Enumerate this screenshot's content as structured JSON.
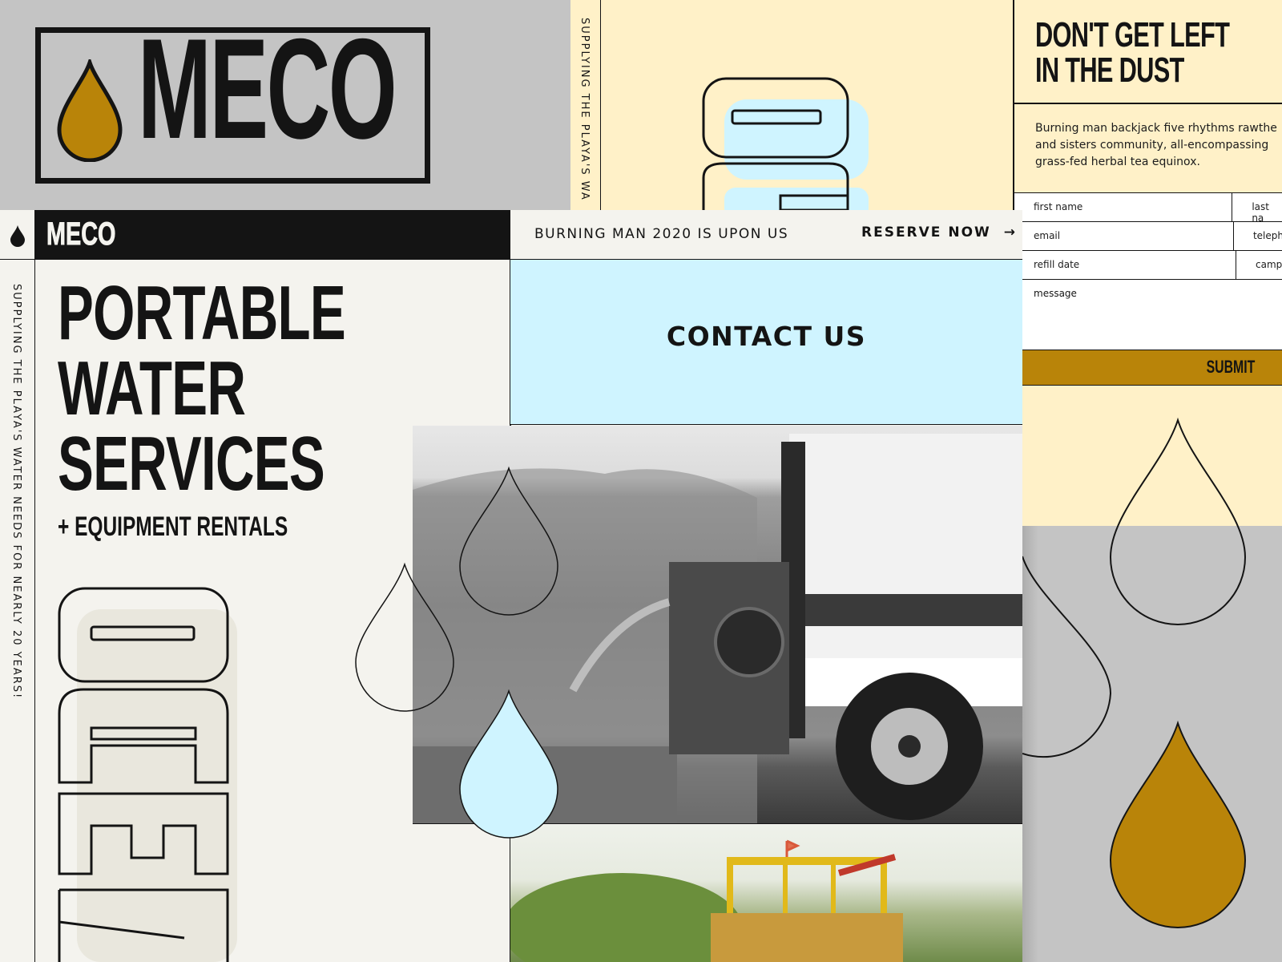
{
  "brand": {
    "logo_text": "MECO",
    "nav_logo_text": "MECO",
    "colors": {
      "ink": "#141414",
      "gold": "#b98409",
      "sky": "#cff4ff",
      "cream": "#fff1c8",
      "paper": "#f4f3ee",
      "gray": "#c4c4c4"
    }
  },
  "side_tagline": "SUPPLYING THE PLAYA'S WATER NEEDS FOR NEARLY 20 YEARS!",
  "side_tagline_top": "SUPPLYING THE PLAYA'S WA",
  "hero": {
    "title_lines": [
      "PORTABLE",
      "WATER",
      "SERVICES"
    ],
    "subtitle": "+ EQUIPMENT RENTALS"
  },
  "announcement": {
    "text": "BURNING MAN 2020 IS UPON US",
    "cta_label": "RESERVE NOW",
    "cta_icon": "arrow-right-icon"
  },
  "contact": {
    "heading": "CONTACT US"
  },
  "form": {
    "title_lines": [
      "DON'T GET LEFT",
      "IN THE DUST"
    ],
    "intro": "Burning man backjack five rhythms rawthe and sisters community, all-encompassing grass-fed herbal tea equinox.",
    "fields": [
      {
        "left": "first name",
        "right": "last na"
      },
      {
        "left": "email",
        "right": "teleph"
      },
      {
        "left": "refill date",
        "right": "camp"
      }
    ],
    "message_label": "message",
    "submit_label": "SUBMIT"
  },
  "icons": [
    "water-drop-icon",
    "arrow-right-icon"
  ]
}
